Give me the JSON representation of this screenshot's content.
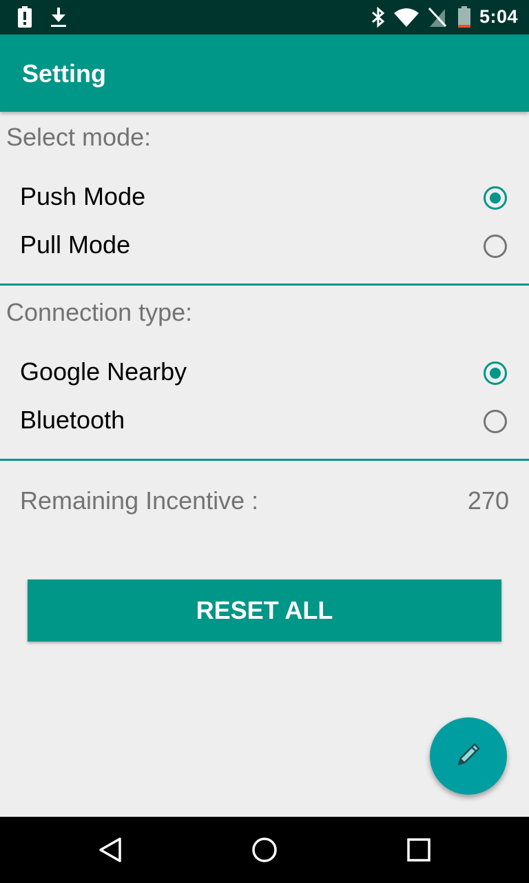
{
  "status_bar": {
    "time": "5:04",
    "icons": [
      "alert-icon",
      "download-icon",
      "bluetooth-icon",
      "wifi-icon",
      "no-sim-icon",
      "battery-icon"
    ]
  },
  "app_bar": {
    "title": "Setting"
  },
  "mode_section": {
    "label": "Select mode:",
    "options": [
      {
        "label": "Push Mode",
        "selected": true
      },
      {
        "label": "Pull Mode",
        "selected": false
      }
    ]
  },
  "connection_section": {
    "label": "Connection type:",
    "options": [
      {
        "label": "Google Nearby",
        "selected": true
      },
      {
        "label": "Bluetooth",
        "selected": false
      }
    ]
  },
  "incentive": {
    "label": "Remaining Incentive :",
    "value": "270"
  },
  "reset_button": {
    "label": "RESET ALL"
  },
  "fab": {
    "icon": "pencil-icon"
  },
  "nav_bar": {
    "icons": [
      "back-icon",
      "home-icon",
      "recents-icon"
    ]
  },
  "colors": {
    "accent": "#009688",
    "status_bar": "#00352e",
    "background": "#eeeeee"
  }
}
